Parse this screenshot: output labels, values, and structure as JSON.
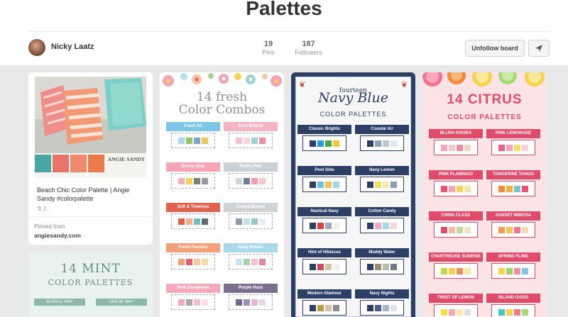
{
  "board": {
    "title": "Palettes"
  },
  "owner": {
    "name": "Nicky Laatz"
  },
  "stats": {
    "pins_count": "19",
    "pins_label": "Pins",
    "followers_count": "187",
    "followers_label": "Followers"
  },
  "actions": {
    "unfollow_label": "Unfollow board",
    "send_icon": "send-icon"
  },
  "pins": {
    "beach": {
      "description": "Beach Chic Color Palette | Angie Sandy #colorpalette",
      "repins": "2",
      "pinned_from_label": "Pinned from",
      "source": "angiesandy.com",
      "brand_line1": "ANGIE SANDY",
      "swatches": [
        "#4aa6a3",
        "#e9746a",
        "#f08a6e",
        "#e97a4a"
      ]
    },
    "mint": {
      "title_line1": "14 MINT",
      "title_line2": "COLOR PALETTES",
      "labels": [
        "BLISSFUL MINT",
        "DEW OF MINT"
      ]
    },
    "fresh": {
      "title_line1": "14 fresh",
      "title_line2": "Color Combos",
      "palettes": [
        {
          "label": "Fresh Air",
          "color": "#7ec6e8",
          "swatches": [
            "#a9d8ef",
            "#95c55b",
            "#7aa7c7",
            "#f2c35b"
          ]
        },
        {
          "label": "Cool Breeze",
          "color": "#f3b4c4",
          "swatches": [
            "#f3c1cd",
            "#f6d8de",
            "#9fd0d6",
            "#ec8fa6"
          ]
        },
        {
          "label": "Sunny Chic",
          "color": "#f5a5b5",
          "swatches": [
            "#f2b1bd",
            "#f6d25a",
            "#7d7d7d",
            "#9a9a9a"
          ]
        },
        {
          "label": "Pretty Pink",
          "color": "#c9d0d6",
          "swatches": [
            "#d0d6dc",
            "#6e7d96",
            "#f49aa8",
            "#f6c7cf"
          ]
        },
        {
          "label": "Soft & Timeless",
          "color": "#e2634d",
          "swatches": [
            "#e2634d",
            "#f4b18c",
            "#73c0c1",
            "#5e6a74"
          ]
        },
        {
          "label": "Cotton Breeze",
          "color": "#cfd3d6",
          "swatches": [
            "#8e9aa7",
            "#c9dfe6",
            "#92c9c1",
            "#e9eff0"
          ]
        },
        {
          "label": "Fresh Passion",
          "color": "#f4a07a",
          "swatches": [
            "#f4a07a",
            "#e15d7a",
            "#f7c99c",
            "#f6d9a6"
          ]
        },
        {
          "label": "Baby Kisses",
          "color": "#a9d8e6",
          "swatches": [
            "#c7e6ef",
            "#a4d4a8",
            "#f4c5cc",
            "#e6869d"
          ]
        },
        {
          "label": "Pink Gentlemen",
          "color": "#f4a9bb",
          "swatches": [
            "#f4a9bb",
            "#a7a7a7",
            "#f2c1cd",
            "#fbe1e6"
          ]
        },
        {
          "label": "Purple Haze",
          "color": "#7c6f8e",
          "swatches": [
            "#6e6a8e",
            "#9d8fb3",
            "#e6b8c9",
            "#e8d9e4"
          ]
        }
      ]
    },
    "navy": {
      "title_line1": "fourteen",
      "title_line2": "Navy Blue",
      "title_line3": "COLOR PALETTES",
      "palettes": [
        {
          "label": "Classic Brights",
          "swatches": [
            "#2e3f66",
            "#2d9ad1",
            "#46a852",
            "#f0c43b"
          ]
        },
        {
          "label": "Coastal Air",
          "swatches": [
            "#2e3f66",
            "#8aa3b5",
            "#b8c7d3",
            "#dfe6ec"
          ]
        },
        {
          "label": "Pool Side",
          "swatches": [
            "#2e3f66",
            "#68c4e1",
            "#f2c34e",
            "#a2d5e9"
          ]
        },
        {
          "label": "Navy Lemon",
          "swatches": [
            "#2e3f66",
            "#f4de5e",
            "#f7e9a8",
            "#8c9ab4"
          ]
        },
        {
          "label": "Nautical Navy",
          "swatches": [
            "#2e3f66",
            "#d9443a",
            "#9aa9bf",
            "#f3f0e6"
          ]
        },
        {
          "label": "Cotton Candy",
          "swatches": [
            "#2e3f66",
            "#f3a6c0",
            "#a6d7ea",
            "#f7d6e2"
          ]
        },
        {
          "label": "Hint of Hibiscus",
          "swatches": [
            "#2e3f66",
            "#d8455f",
            "#c8caa0",
            "#eeeeee"
          ]
        },
        {
          "label": "Muddy Water",
          "swatches": [
            "#2e3f66",
            "#9a8a6a",
            "#bcbcae",
            "#6f7a8a"
          ]
        },
        {
          "label": "Modern Glamour",
          "swatches": [
            "#2e3f66",
            "#b99b4a",
            "#d4c2a4",
            "#8d8d8d"
          ]
        },
        {
          "label": "Navy Nights",
          "swatches": [
            "#2e3f66",
            "#4b5f8c",
            "#a9b4c9",
            "#dde2ec"
          ]
        }
      ]
    },
    "citrus": {
      "title_line1": "14 CITRUS",
      "title_line2": "COLOR PALETTES",
      "palettes": [
        {
          "label": "BLUSH KISSES",
          "swatches": [
            "#f4a8b3",
            "#f7c6cd",
            "#e88ea0",
            "#f6d2c0"
          ]
        },
        {
          "label": "PINK LEMONADE",
          "swatches": [
            "#e8628a",
            "#f4a6be",
            "#f7dd6a",
            "#f6cfd9"
          ]
        },
        {
          "label": "PINK FLAMINGO",
          "swatches": [
            "#f24f74",
            "#f7a2b6",
            "#f9d05a",
            "#f7e3a7"
          ]
        },
        {
          "label": "TANGERINE TANGO",
          "swatches": [
            "#f6873f",
            "#f5b041",
            "#7ac7c0",
            "#f04c7a"
          ]
        },
        {
          "label": "CHINA CLASS",
          "swatches": [
            "#e04b6a",
            "#f3b9a8",
            "#c4d6a0",
            "#f0e2c6"
          ]
        },
        {
          "label": "SUNSET MIMOSA",
          "swatches": [
            "#f49a55",
            "#f6c35b",
            "#f27393",
            "#fad9a8"
          ]
        },
        {
          "label": "CHARTREUSE SUNRISE",
          "swatches": [
            "#c3d844",
            "#f4cf50",
            "#f08c5a",
            "#fbe6a6"
          ]
        },
        {
          "label": "SPRING FLING",
          "swatches": [
            "#f4d44d",
            "#9fd16a",
            "#f48aa6",
            "#7ec6e8"
          ]
        },
        {
          "label": "TWIST OF LEMON",
          "swatches": [
            "#f7e046",
            "#f4a6bb",
            "#fbe9a5",
            "#e0e0e0"
          ]
        },
        {
          "label": "ISLAND OASIS",
          "swatches": [
            "#4ac3c0",
            "#f4d44d",
            "#f27a8f",
            "#a4d978"
          ]
        }
      ]
    }
  }
}
